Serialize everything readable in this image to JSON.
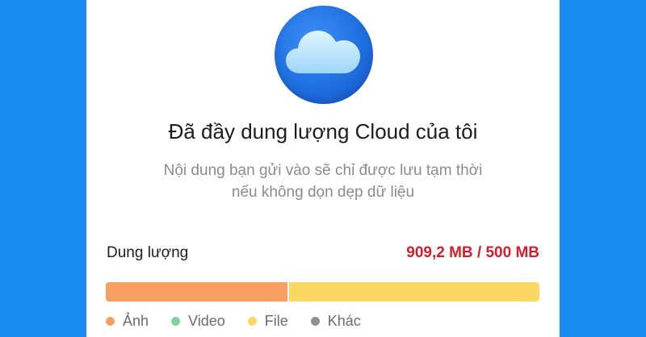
{
  "header": {
    "icon": "cloud-icon",
    "title": "Đã đầy dung lượng Cloud của tôi",
    "subtitle_line1": "Nội dung bạn gửi vào sẽ chỉ được lưu tạm thời",
    "subtitle_line2": "nếu không dọn dẹp dữ liệu"
  },
  "storage": {
    "label": "Dung lượng",
    "usage_text": "909,2 MB / 500 MB",
    "usage_color": "#d0202d",
    "bar_segments": [
      {
        "category": "Ảnh",
        "fraction": 0.42,
        "color": "#f8a062"
      },
      {
        "category": "File",
        "fraction": 0.58,
        "color": "#fbd863"
      }
    ]
  },
  "legend": {
    "items": [
      {
        "label": "Ảnh",
        "color": "#f8a062"
      },
      {
        "label": "Video",
        "color": "#7ed39b"
      },
      {
        "label": "File",
        "color": "#fbd863"
      },
      {
        "label": "Khác",
        "color": "#8e8e93"
      }
    ]
  }
}
